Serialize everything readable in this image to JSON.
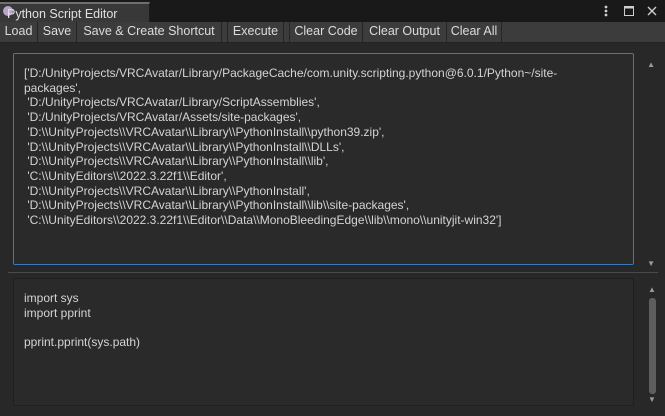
{
  "window": {
    "title": "Python Script Editor",
    "icons": [
      "more-options-icon",
      "maximize-icon",
      "close-icon"
    ]
  },
  "toolbar": {
    "buttons": [
      "Load",
      "Save",
      "Save & Create Shortcut",
      "Execute",
      "Clear Code",
      "Clear Output",
      "Clear All"
    ]
  },
  "output": {
    "text": "['D:/UnityProjects/VRCAvatar/Library/PackageCache/com.unity.scripting.python@6.0.1/Python~/site-\npackages',\n 'D:/UnityProjects/VRCAvatar/Library/ScriptAssemblies',\n 'D:/UnityProjects/VRCAvatar/Assets/site-packages',\n 'D:\\\\UnityProjects\\\\VRCAvatar\\\\Library\\\\PythonInstall\\\\python39.zip',\n 'D:\\\\UnityProjects\\\\VRCAvatar\\\\Library\\\\PythonInstall\\\\DLLs',\n 'D:\\\\UnityProjects\\\\VRCAvatar\\\\Library\\\\PythonInstall\\\\lib',\n 'C:\\\\UnityEditors\\\\2022.3.22f1\\\\Editor',\n 'D:\\\\UnityProjects\\\\VRCAvatar\\\\Library\\\\PythonInstall',\n 'D:\\\\UnityProjects\\\\VRCAvatar\\\\Library\\\\PythonInstall\\\\lib\\\\site-packages',\n 'C:\\\\UnityEditors\\\\2022.3.22f1\\\\Editor\\\\Data\\\\MonoBleedingEdge\\\\lib\\\\mono\\\\unityjit-win32']"
  },
  "code": {
    "text": "import sys\nimport pprint\n\npprint.pprint(sys.path)"
  }
}
